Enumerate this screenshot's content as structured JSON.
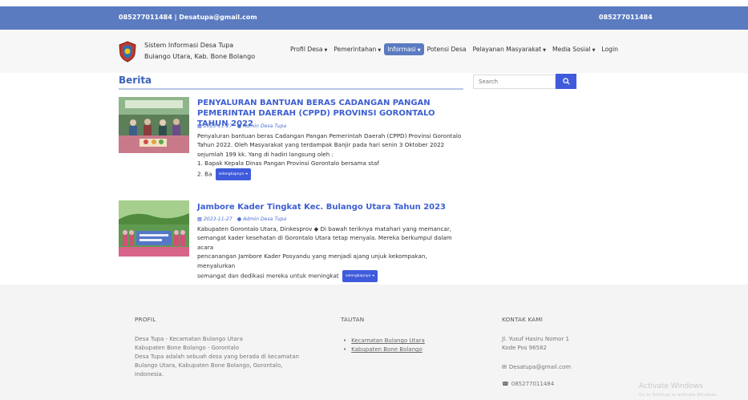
{
  "topbar": {
    "contact_left": "085277011484 | Desatupa@gmail.com",
    "contact_right": "085277011484"
  },
  "brand": {
    "title": "Sistem Informasi Desa Tupa",
    "subtitle": "Bulango Utara, Kab. Bone Bolango"
  },
  "menu": [
    {
      "label": "Profil Desa",
      "dropdown": true,
      "active": false
    },
    {
      "label": "Pemerintahan",
      "dropdown": true,
      "active": false
    },
    {
      "label": "Informasi",
      "dropdown": true,
      "active": true
    },
    {
      "label": "Potensi Desa",
      "dropdown": false,
      "active": false
    },
    {
      "label": "Pelayanan Masyarakat",
      "dropdown": true,
      "active": false
    },
    {
      "label": "Media Sosial",
      "dropdown": true,
      "active": false
    },
    {
      "label": "Login",
      "dropdown": false,
      "active": false
    }
  ],
  "main": {
    "section_title": "Berita"
  },
  "search": {
    "placeholder": "Search"
  },
  "posts": [
    {
      "title": "PENYALURAN BANTUAN BERAS CADANGAN PANGAN PEMERINTAH DAERAH (CPPD) PROVINSI GORONTALO TAHUN 2022",
      "date": "2023-11-27",
      "author": "Admin Desa Tupa",
      "excerpt_lines": [
        "Penyaluran bantuan beras Cadangan Pangan Pemerintah Daerah (CPPD) Provinsi Gorontalo",
        "Tahun 2022. Oleh Masyarakat yang terdampak Banjir pada hari senin 3 Oktober 2022",
        "sejumlah 199 kk. Yang di hadiri langsung oleh :",
        "1. Bapak Kepala Dinas Pangan Provinsi Gorontalo bersama staf",
        "2. Ba"
      ],
      "more_label": "selengkapnya"
    },
    {
      "title": "Jambore Kader Tingkat Kec. Bulango Utara Tahun 2023",
      "date": "2023-11-27",
      "author": "Admin Desa Tupa",
      "excerpt_lines": [
        "Kabupaten Gorontalo Utara, Dinkesprov ◆ Di bawah teriknya matahari yang memancar,",
        "semangat kader kesehatan di Gorontalo Utara tetap menyala. Mereka berkumpul dalam acara",
        "pencanangan Jambore Kader Posyandu yang menjadi ajang unjuk kekompakan, menyalurkan",
        "semangat dan dedikasi mereka untuk meningkat"
      ],
      "more_label": "selengkapnya"
    }
  ],
  "footer": {
    "profil": {
      "heading": "PROFIL",
      "lines": [
        "Desa Tupa - Kecamatan Bulango Utara",
        "Kabupaten Bone Bolango - Gorontalo",
        "Desa Tupa adalah sebuah desa yang berada di kecamatan",
        "Bulango Utara, Kabupaten Bone Bolango, Gorontalo,",
        "Indonesia."
      ]
    },
    "tautan": {
      "heading": "TAUTAN",
      "links": [
        "Kecamatan Bulango Utara",
        "Kabupaten Bone Bolango"
      ]
    },
    "kontak": {
      "heading": "KONTAK KAMI",
      "address_line1": "Jl. Yusuf Hasiru Nomor 1",
      "address_line2": "Kode Pos 96582",
      "email": "Desatupa@gmail.com",
      "phone": "085277011484"
    }
  },
  "watermark": {
    "title": "Activate Windows",
    "subtitle": "Go to Settings to activate Windows."
  },
  "colors": {
    "primary": "#5b7bc0",
    "button": "#3f5bdc",
    "link": "#3d5fd1"
  }
}
